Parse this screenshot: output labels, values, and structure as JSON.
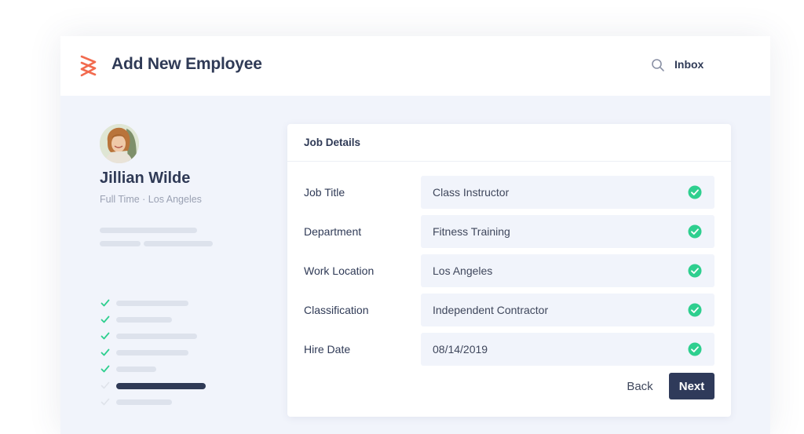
{
  "header": {
    "title": "Add New Employee",
    "inbox_label": "Inbox"
  },
  "colors": {
    "logo": "#f26b4f",
    "accent": "#2f3a5a",
    "success": "#2ecf8f"
  },
  "profile": {
    "name": "Jillian Wilde",
    "subtitle": "Full Time · Los Angeles"
  },
  "steps": [
    {
      "state": "done"
    },
    {
      "state": "done"
    },
    {
      "state": "done"
    },
    {
      "state": "done"
    },
    {
      "state": "done"
    },
    {
      "state": "current"
    },
    {
      "state": "pending"
    }
  ],
  "card": {
    "title": "Job Details",
    "fields": [
      {
        "label": "Job Title",
        "value": "Class Instructor",
        "icon": "check-circle-icon"
      },
      {
        "label": "Department",
        "value": "Fitness Training",
        "icon": "check-circle-icon"
      },
      {
        "label": "Work Location",
        "value": "Los Angeles",
        "icon": "check-circle-icon"
      },
      {
        "label": "Classification",
        "value": "Independent Contractor",
        "icon": "check-circle-icon"
      },
      {
        "label": "Hire Date",
        "value": "08/14/2019",
        "icon": "check-circle-icon"
      }
    ],
    "back_label": "Back",
    "next_label": "Next"
  }
}
